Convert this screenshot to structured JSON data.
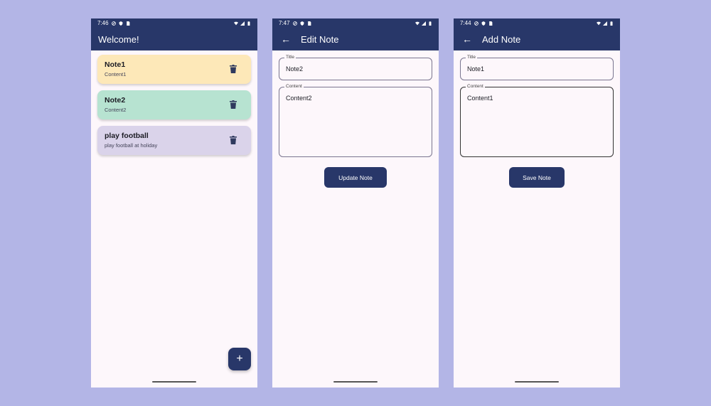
{
  "colors": {
    "background": "#b3b5e6",
    "appbar": "#283769",
    "screen": "#fdf7fb"
  },
  "screen1": {
    "status_time": "7:46",
    "title": "Welcome!",
    "notes": [
      {
        "title": "Note1",
        "content": "Content1",
        "color": "#fde8b8"
      },
      {
        "title": "Note2",
        "content": "Content2",
        "color": "#b7e3d1"
      },
      {
        "title": "play football",
        "content": "play football at holiday",
        "color": "#dad3ea"
      }
    ],
    "fab_label": "+"
  },
  "screen2": {
    "status_time": "7:47",
    "title": "Edit Note",
    "title_label": "Title",
    "title_value": "Note2",
    "content_label": "Content",
    "content_value": "Content2",
    "button_label": "Update Note"
  },
  "screen3": {
    "status_time": "7:44",
    "title": "Add Note",
    "title_label": "Title",
    "title_value": "Note1",
    "content_label": "Content",
    "content_value": "Content1",
    "button_label": "Save Note"
  }
}
